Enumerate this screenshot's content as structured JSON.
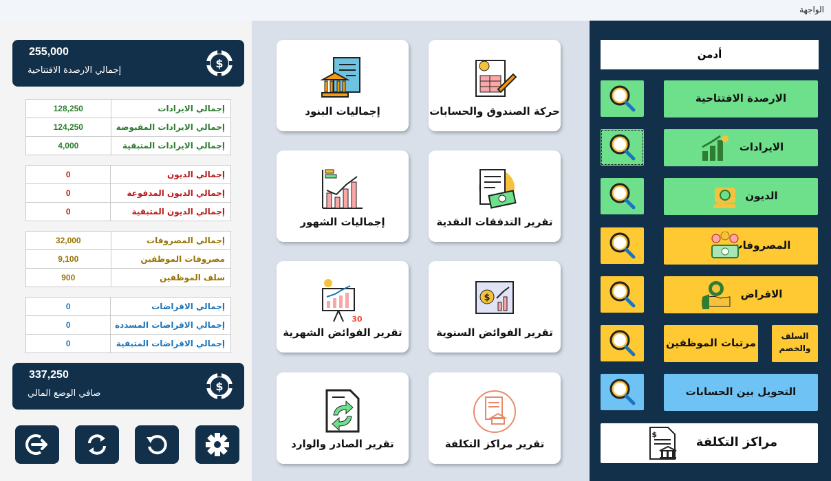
{
  "window": {
    "title": "الواجهة"
  },
  "summary": {
    "opening_total": {
      "value": "255,000",
      "label": "إجمالي الارصدة الافتتاحية"
    },
    "net_total": {
      "value": "337,250",
      "label": "صافي الوضع المالي"
    }
  },
  "revenues": [
    {
      "label": "إجمالي الايرادات",
      "value": "128,250"
    },
    {
      "label": "إجمالي الايرادات المقبوضة",
      "value": "124,250"
    },
    {
      "label": "إجمالي الايرادات المتبقية",
      "value": "4,000"
    }
  ],
  "debts": [
    {
      "label": "إجمالي الديون",
      "value": "0"
    },
    {
      "label": "إجمالي الديون المدفوعة",
      "value": "0"
    },
    {
      "label": "إجمالي الديون المتبقية",
      "value": "0"
    }
  ],
  "expenses": [
    {
      "label": "إجمالي المصروفات",
      "value": "32,000"
    },
    {
      "label": "مصروفات الموظفين",
      "value": "9,100"
    },
    {
      "label": "سلف الموظفين",
      "value": "900"
    }
  ],
  "loans": [
    {
      "label": "إجمالي الاقراضات",
      "value": "0"
    },
    {
      "label": "إجمالي الاقراضات المسددة",
      "value": "0"
    },
    {
      "label": "إجمالي الاقراضات المتبقية",
      "value": "0"
    }
  ],
  "reports": {
    "items_totals": "إجماليات البنود",
    "cashbox_movement": "حركة الصندوق والحسابات",
    "monthly_totals": "إجماليات الشهور",
    "cashflow_report": "تقرير التدفقات النقدية",
    "monthly_surplus": "تقرير الفوائض الشهرية",
    "annual_surplus": "تقرير الفوائض السنوية",
    "inout_report": "تقرير الصادر والوارد",
    "cost_centers_report": "تقرير مراكز التكلفة"
  },
  "nav": {
    "user": "أدمن",
    "opening_balances": "الارصدة الافتتاحية",
    "revenues": "الايرادات",
    "debts": "الديون",
    "expenses": "المصروفات",
    "loans": "الاقراض",
    "salaries": "مرتبات الموظفين",
    "advances_line1": "السلف",
    "advances_line2": "والخصم",
    "transfer": "التحويل بين الحسابات",
    "cost_centers": "مراكز التكلفة"
  },
  "colors": {
    "navy": "#13304a",
    "green": "#6ee08c",
    "yellow": "#ffc933",
    "blue": "#6ec3f4",
    "middle_bg": "#d9e0ea"
  }
}
